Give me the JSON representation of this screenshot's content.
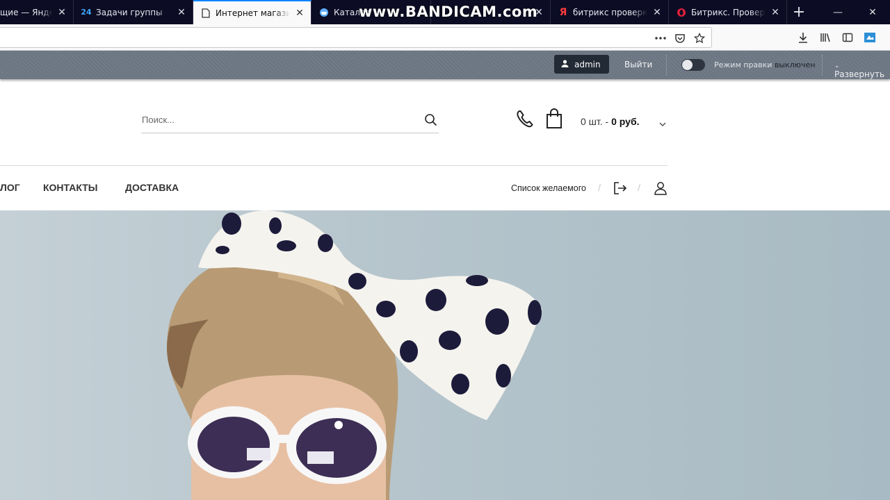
{
  "browser": {
    "tabs": [
      {
        "title": "щие — Яндекс",
        "favicon": "yandex-icon"
      },
      {
        "title": "Задачи группы",
        "favicon": "bitrix24-icon"
      },
      {
        "title": "Интернет магазин ж",
        "favicon": "page-icon",
        "active": true
      },
      {
        "title": "Каталог",
        "favicon": "basket-icon"
      },
      {
        "title": "",
        "favicon": "blank-icon"
      },
      {
        "title": "битрикс проверка н",
        "favicon": "yandex-icon"
      },
      {
        "title": "Битрикс. Проверка",
        "favicon": "opera-icon"
      }
    ],
    "new_tab": "+",
    "watermark": "www.BANDICAM.com",
    "url": "",
    "colors": {
      "tabstrip": "#0c0c24",
      "active_tab": "#f9f9fa",
      "accent": "#0a84ff"
    }
  },
  "admin_panel": {
    "user": "admin",
    "logout": "Выйти",
    "edit_mode_label": "Режим правки",
    "edit_mode_state": "выключен",
    "expand": "Развернуть"
  },
  "header": {
    "search_placeholder": "Поиск...",
    "cart_count": "0 шт.",
    "cart_sep": " - ",
    "cart_sum": "0 руб."
  },
  "nav": {
    "items": [
      "ЛОГ",
      "КОНТАКТЫ",
      "ДОСТАВКА"
    ],
    "wishlist": "Список желаемого",
    "divider": "/"
  }
}
